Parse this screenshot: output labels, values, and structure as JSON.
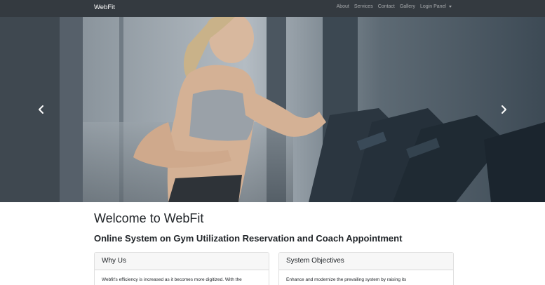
{
  "navbar": {
    "brand": "WebFit",
    "links": [
      {
        "label": "About"
      },
      {
        "label": "Services"
      },
      {
        "label": "Contact"
      },
      {
        "label": "Gallery"
      },
      {
        "label": "Login Panel"
      }
    ]
  },
  "carousel": {
    "prev_icon": "chevron-left-icon",
    "next_icon": "chevron-right-icon"
  },
  "main": {
    "title": "Welcome to WebFit",
    "subtitle": "Online System on Gym Utilization Reservation and Coach Appointment",
    "cards": [
      {
        "header": "Why Us",
        "body": "Webfit's efficiency is increased as it becomes more digitized. With the"
      },
      {
        "header": "System Objectives",
        "body": "Enhance and modernize the prevailing system by raising its"
      }
    ]
  },
  "colors": {
    "navbar_bg": "#343a40",
    "nav_text": "rgba(255,255,255,0.55)",
    "card_header_bg": "#f7f7f7"
  }
}
